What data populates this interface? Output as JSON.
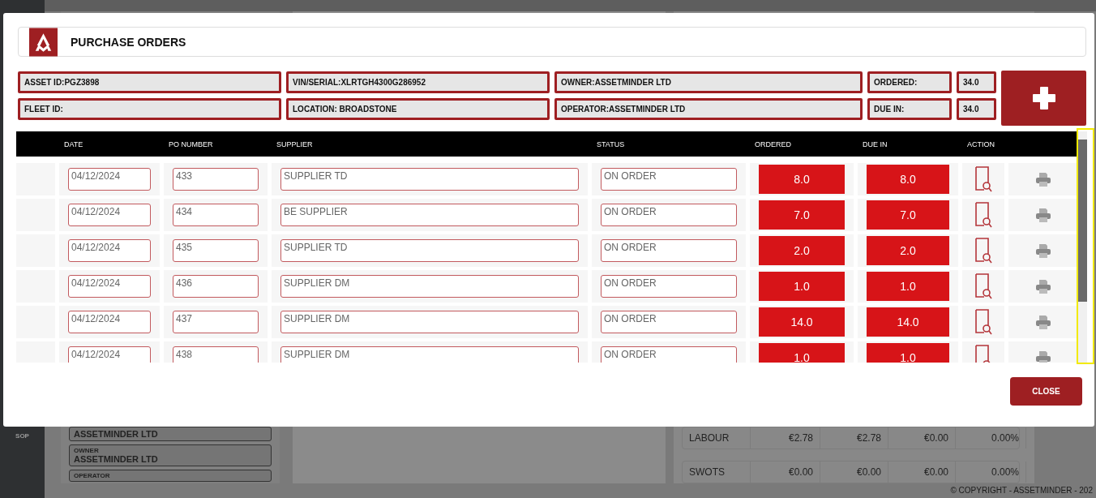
{
  "background": {
    "sidebar_label": "SOP",
    "asset_fields": [
      {
        "value": "ASSETMINDER LTD"
      },
      {
        "label": "OWNER",
        "value": "ASSETMINDER LTD"
      },
      {
        "label": "OPERATOR"
      }
    ],
    "cost_rows": [
      {
        "name": "LABOUR",
        "values": [
          "€2.78",
          "€2.78",
          "€0.00",
          "0.00%"
        ]
      },
      {
        "name": "SWOTS",
        "values": [
          "€0.00",
          "€0.00",
          "€0.00",
          "0.00%"
        ]
      }
    ],
    "copyright": "© COPYRIGHT - ASSETMINDER - 202"
  },
  "modal": {
    "title": "PURCHASE ORDERS",
    "info": [
      {
        "text": "ASSET ID:PGZ3898"
      },
      {
        "text": "VIN/SERIAL:XLRTGH4300G286952"
      },
      {
        "text": "OWNER:ASSETMINDER LTD"
      },
      {
        "text": "ORDERED:"
      },
      {
        "text": "34.0"
      },
      {
        "text": "FLEET ID:"
      },
      {
        "text": "LOCATION: BROADSTONE"
      },
      {
        "text": "OPERATOR:ASSETMINDER LTD"
      },
      {
        "text": "DUE IN:"
      },
      {
        "text": "34.0"
      }
    ],
    "table": {
      "columns": [
        "DATE",
        "PO NUMBER",
        "SUPPLIER",
        "STATUS",
        "ORDERED",
        "DUE IN",
        "ACTION"
      ],
      "rows": [
        {
          "date": "04/12/2024",
          "po": "433",
          "supplier": "SUPPLIER TD",
          "status": "ON ORDER",
          "ordered": "8.0",
          "due_in": "8.0"
        },
        {
          "date": "04/12/2024",
          "po": "434",
          "supplier": "BE SUPPLIER",
          "status": "ON ORDER",
          "ordered": "7.0",
          "due_in": "7.0"
        },
        {
          "date": "04/12/2024",
          "po": "435",
          "supplier": "SUPPLIER TD",
          "status": "ON ORDER",
          "ordered": "2.0",
          "due_in": "2.0"
        },
        {
          "date": "04/12/2024",
          "po": "436",
          "supplier": "SUPPLIER DM",
          "status": "ON ORDER",
          "ordered": "1.0",
          "due_in": "1.0"
        },
        {
          "date": "04/12/2024",
          "po": "437",
          "supplier": "SUPPLIER DM",
          "status": "ON ORDER",
          "ordered": "14.0",
          "due_in": "14.0"
        },
        {
          "date": "04/12/2024",
          "po": "438",
          "supplier": "SUPPLIER DM",
          "status": "ON ORDER",
          "ordered": "1.0",
          "due_in": "1.0"
        }
      ]
    },
    "close_button": "CLOSE"
  }
}
